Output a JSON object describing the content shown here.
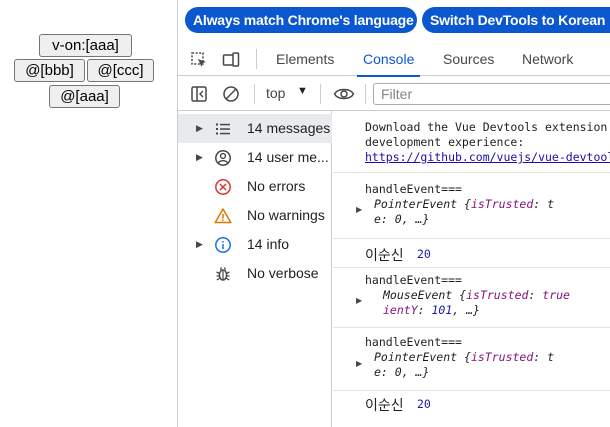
{
  "demo": {
    "btn_von": "v-on:[aaa]",
    "btn_bbb": "@[bbb]",
    "btn_ccc": "@[ccc]",
    "btn_aaa": "@[aaa]"
  },
  "lang_bar": {
    "match_language": "Always match Chrome's language",
    "switch_korean": "Switch DevTools to Korean"
  },
  "tabs": {
    "elements": "Elements",
    "console": "Console",
    "sources": "Sources",
    "network": "Network"
  },
  "toolbar": {
    "context": "top",
    "filter_placeholder": "Filter"
  },
  "sidebar": {
    "items": [
      {
        "label": "14 messages",
        "icon": "list-icon"
      },
      {
        "label": "14 user me...",
        "icon": "user-icon"
      },
      {
        "label": "No errors",
        "icon": "error-icon"
      },
      {
        "label": "No warnings",
        "icon": "warning-icon"
      },
      {
        "label": "14 info",
        "icon": "info-icon"
      },
      {
        "label": "No verbose",
        "icon": "bug-icon"
      }
    ]
  },
  "console": {
    "m1_line1": "Download the Vue Devtools extension for a better",
    "m1_line2": "development experience:",
    "m1_link": "https://github.com/vuejs/vue-devtools",
    "m2_head": "handleEvent===",
    "m2_type": "PointerEvent",
    "m2_key": "isTrusted",
    "m2_rest": "e: 0, …}",
    "m3_name": "이순신",
    "m3_num": "20",
    "m4_head": "handleEvent===",
    "m4_type": "MouseEvent",
    "m4_key": "isTrusted",
    "m4_val": "true",
    "m4_rest_key": "ientY",
    "m4_rest_num": "101",
    "m4_rest_tail": ", …}",
    "m5_head": "handleEvent===",
    "m5_type": "PointerEvent",
    "m5_key": "isTrusted",
    "m5_rest": "e: 0, …}",
    "m6_name": "이순신",
    "m6_num": "20"
  },
  "colors": {
    "accent": "#0b57d0",
    "error": "#dc362e",
    "warning": "#e37400",
    "info": "#1a73e8"
  }
}
